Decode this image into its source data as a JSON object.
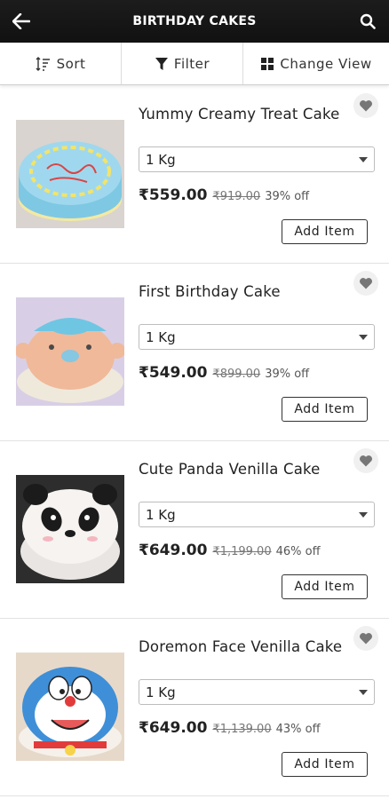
{
  "header": {
    "title": "BIRTHDAY CAKES",
    "back_icon": "arrow-left-icon",
    "search_icon": "search-icon"
  },
  "toolbar": {
    "sort": "Sort",
    "filter": "Filter",
    "view": "Change View"
  },
  "colors": {
    "appbar": "#151515",
    "heart_bg": "#f0f0f0",
    "heart_icon": "#777777"
  },
  "products": [
    {
      "name": "Yummy Creamy Treat Cake",
      "weight": "1 Kg",
      "price": "₹559.00",
      "mrp": "₹919.00",
      "discount": "39% off",
      "add": "Add Item"
    },
    {
      "name": "First Birthday Cake",
      "weight": "1 Kg",
      "price": "₹549.00",
      "mrp": "₹899.00",
      "discount": "39% off",
      "add": "Add Item"
    },
    {
      "name": "Cute Panda Venilla Cake",
      "weight": "1 Kg",
      "price": "₹649.00",
      "mrp": "₹1,199.00",
      "discount": "46% off",
      "add": "Add Item"
    },
    {
      "name": "Doremon Face Venilla Cake",
      "weight": "1 Kg",
      "price": "₹649.00",
      "mrp": "₹1,139.00",
      "discount": "43% off",
      "add": "Add Item"
    }
  ]
}
